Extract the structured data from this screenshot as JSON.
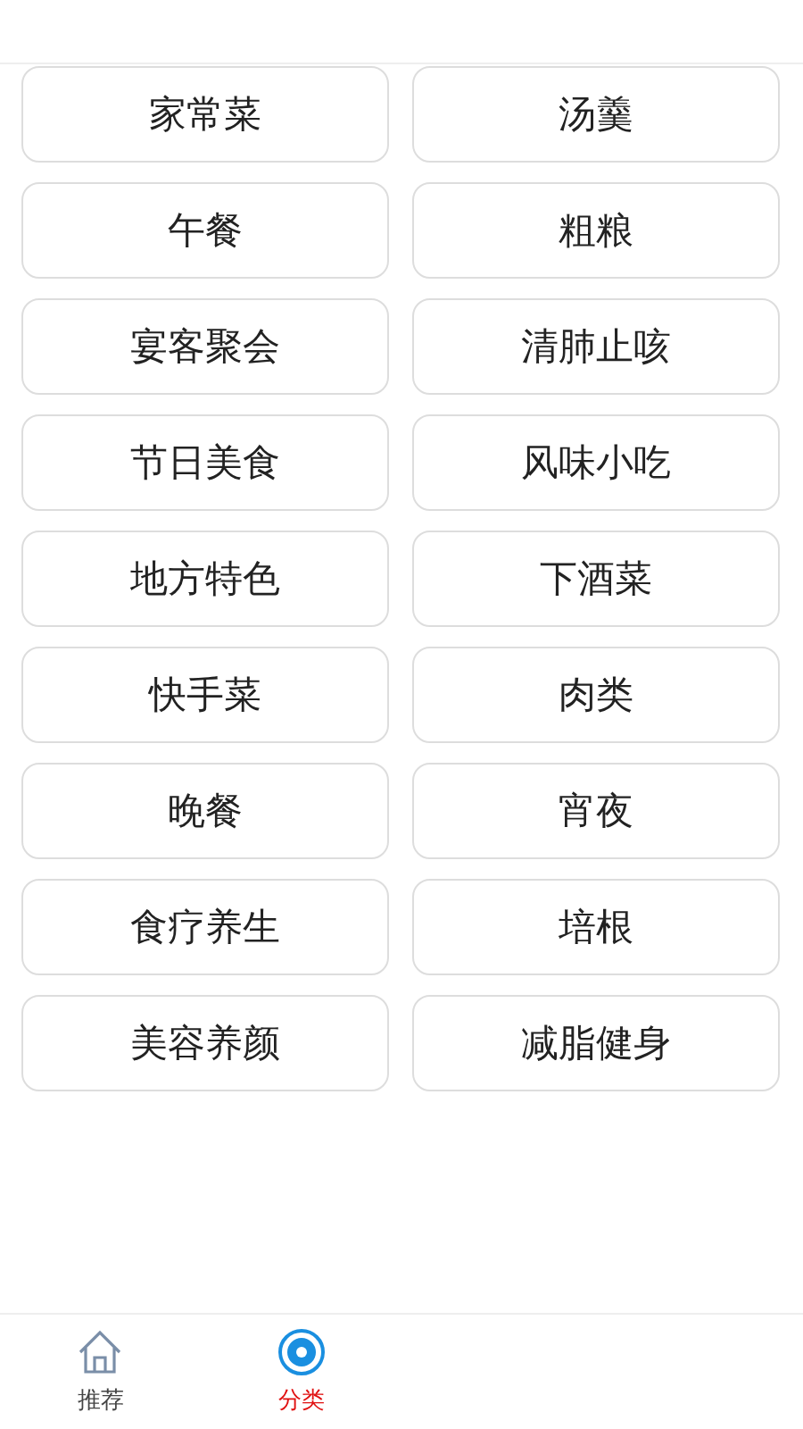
{
  "categories": [
    "家常菜",
    "汤羹",
    "午餐",
    "粗粮",
    "宴客聚会",
    "清肺止咳",
    "节日美食",
    "风味小吃",
    "地方特色",
    "下酒菜",
    "快手菜",
    "肉类",
    "晚餐",
    "宵夜",
    "食疗养生",
    "培根",
    "美容养颜",
    "减脂健身"
  ],
  "tab_bar": [
    {
      "label": "推荐",
      "kind": "home",
      "selected": false
    },
    {
      "label": "分类",
      "kind": "disc",
      "selected": true
    }
  ]
}
